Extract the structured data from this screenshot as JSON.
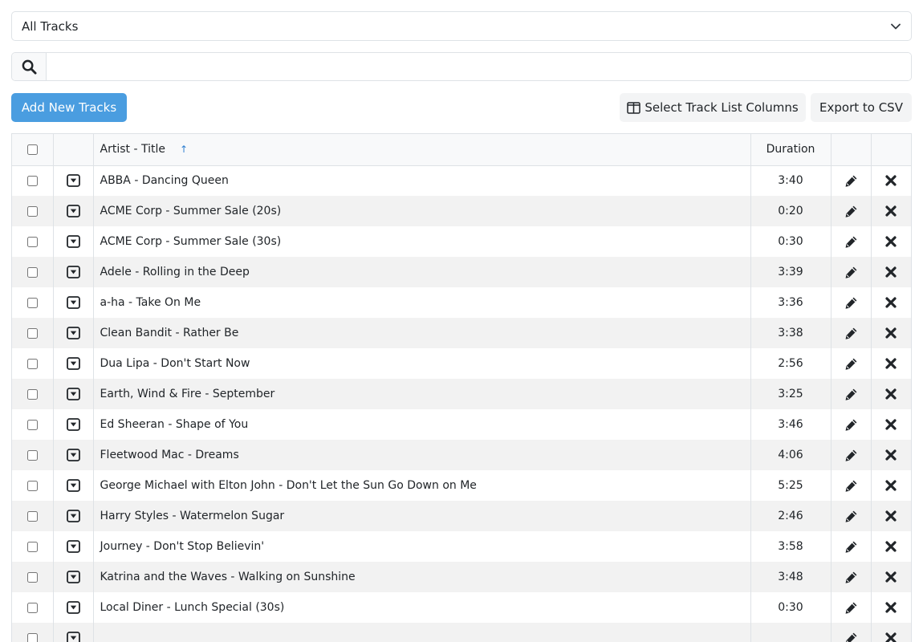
{
  "filter": {
    "selected": "All Tracks"
  },
  "search": {
    "value": "",
    "placeholder": ""
  },
  "toolbar": {
    "add_label": "Add New Tracks",
    "columns_label": "Select Track List Columns",
    "export_label": "Export to CSV"
  },
  "table": {
    "headers": {
      "title": "Artist - Title",
      "duration": "Duration"
    },
    "sort_indicator": "↑",
    "rows": [
      {
        "title": "ABBA - Dancing Queen",
        "duration": "3:40"
      },
      {
        "title": "ACME Corp - Summer Sale (20s)",
        "duration": "0:20"
      },
      {
        "title": "ACME Corp - Summer Sale (30s)",
        "duration": "0:30"
      },
      {
        "title": "Adele - Rolling in the Deep",
        "duration": "3:39"
      },
      {
        "title": "a-ha - Take On Me",
        "duration": "3:36"
      },
      {
        "title": "Clean Bandit - Rather Be",
        "duration": "3:38"
      },
      {
        "title": "Dua Lipa - Don't Start Now",
        "duration": "2:56"
      },
      {
        "title": "Earth, Wind & Fire - September",
        "duration": "3:25"
      },
      {
        "title": "Ed Sheeran - Shape of You",
        "duration": "3:46"
      },
      {
        "title": "Fleetwood Mac - Dreams",
        "duration": "4:06"
      },
      {
        "title": "George Michael with Elton John - Don't Let the Sun Go Down on Me",
        "duration": "5:25"
      },
      {
        "title": "Harry Styles - Watermelon Sugar",
        "duration": "2:46"
      },
      {
        "title": "Journey - Don't Stop Believin'",
        "duration": "3:58"
      },
      {
        "title": "Katrina and the Waves - Walking on Sunshine",
        "duration": "3:48"
      },
      {
        "title": "Local Diner - Lunch Special (30s)",
        "duration": "0:30"
      },
      {
        "title": "",
        "duration": ""
      }
    ]
  },
  "colors": {
    "primary": "#4a9de0",
    "border": "#dee2e6",
    "stripe": "#f2f2f2",
    "sort_arrow": "#2f7fd0"
  }
}
